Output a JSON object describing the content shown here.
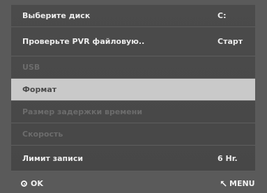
{
  "menu": {
    "rows": [
      {
        "label": "Выберите диск",
        "value": "C:",
        "state": "normal"
      },
      {
        "label": "Проверьте PVR файловую..",
        "value": "Старт",
        "state": "normal"
      },
      {
        "label": "USB",
        "value": "",
        "state": "disabled"
      },
      {
        "label": "Формат",
        "value": "",
        "state": "selected"
      },
      {
        "label": "Размер задержки времени",
        "value": "",
        "state": "disabled"
      },
      {
        "label": "Скорость",
        "value": "",
        "state": "disabled"
      },
      {
        "label": "Лимит записи",
        "value": "6 Hr.",
        "state": "normal"
      }
    ]
  },
  "footer": {
    "ok_label": "OK",
    "menu_label": "MENU",
    "ok_icon": "ok-circle-icon",
    "menu_icon": "return-arrow-icon"
  },
  "colors": {
    "panel_bg": "#4b4b4b",
    "selected_bg": "#c9c9c9",
    "text": "#ececec",
    "disabled_text": "#6c6c6c"
  }
}
